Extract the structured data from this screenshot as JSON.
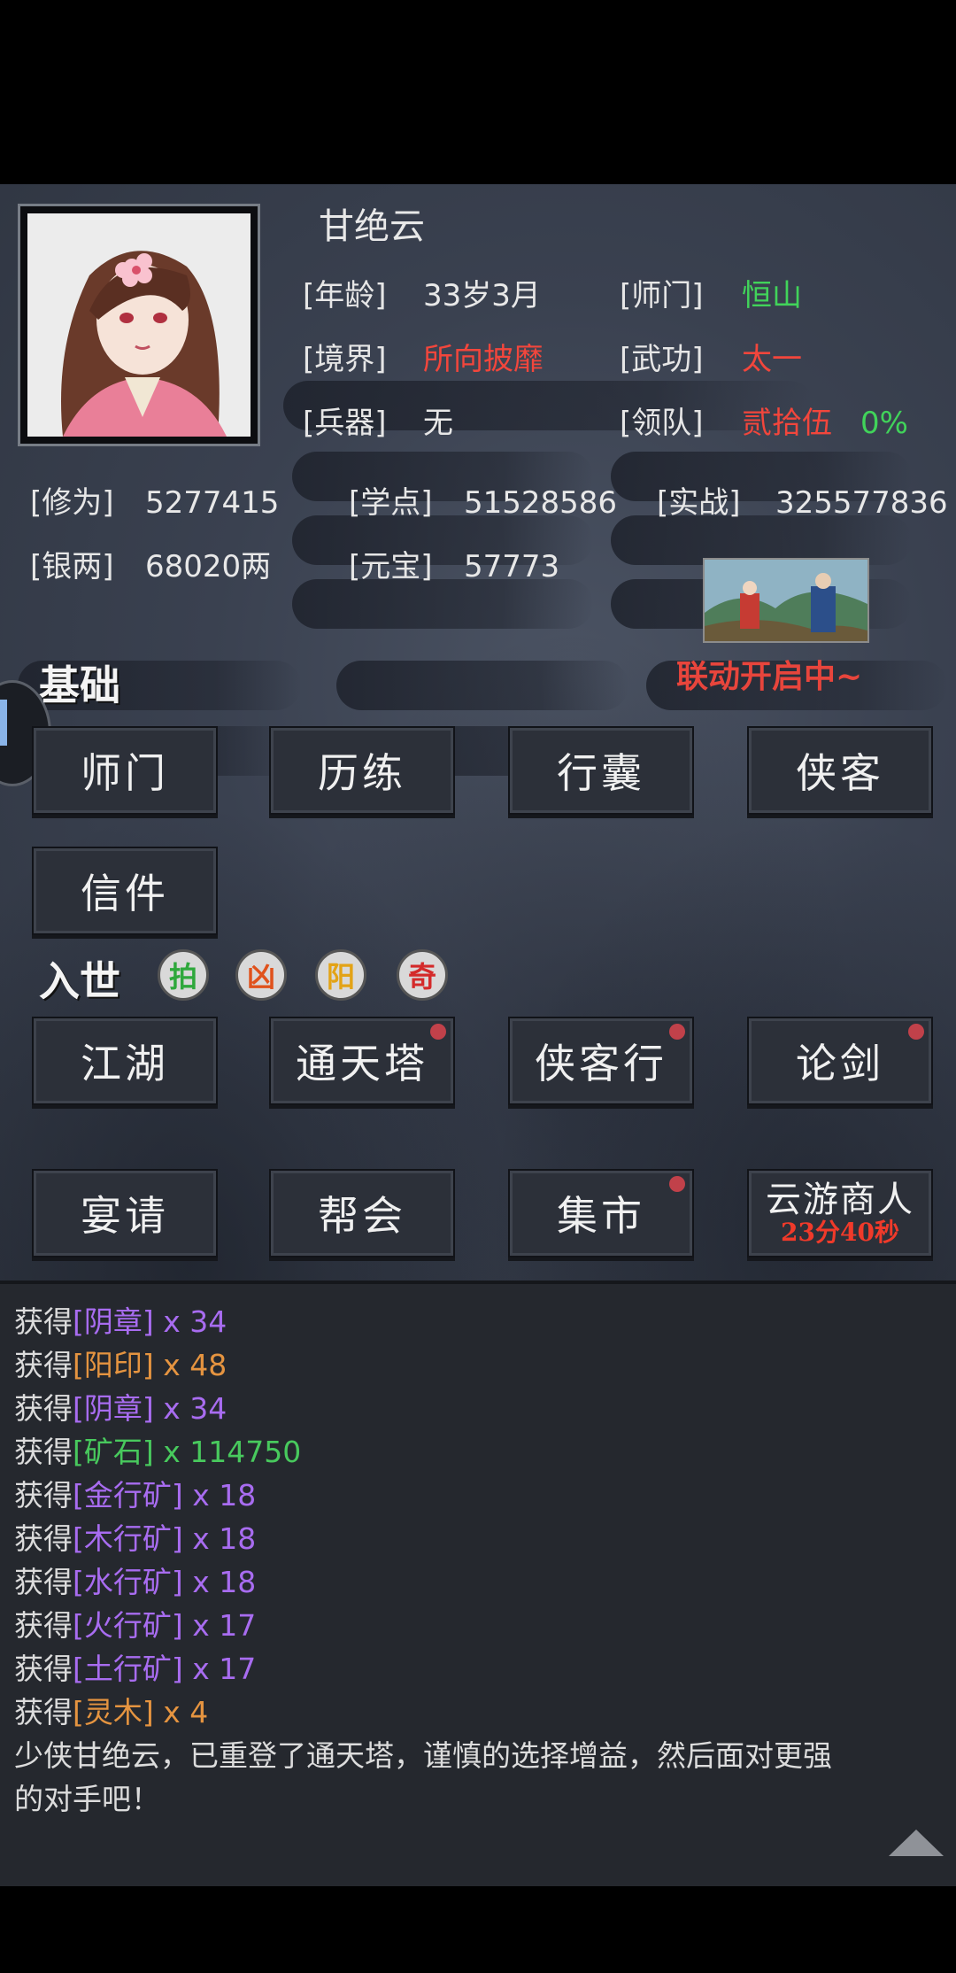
{
  "character": {
    "name": "甘绝云",
    "age_label": "[年龄]",
    "age_value": "33岁3月",
    "sect_label": "[师门]",
    "sect_value": "恒山",
    "realm_label": "[境界]",
    "realm_value": "所向披靡",
    "martial_label": "[武功]",
    "martial_value": "太一",
    "weapon_label": "[兵器]",
    "weapon_value": "无",
    "team_label": "[领队]",
    "team_value": "贰拾伍",
    "team_percent": "0%"
  },
  "stats": {
    "cultivation_label": "[修为]",
    "cultivation_value": "5277415",
    "study_label": "[学点]",
    "study_value": "51528586",
    "combat_label": "[实战]",
    "combat_value": "325577836",
    "silver_label": "[银两]",
    "silver_value": "68020两",
    "ingot_label": "[元宝]",
    "ingot_value": "57773"
  },
  "event": {
    "label": "联动开启中~"
  },
  "basic": {
    "title": "基础",
    "buttons": [
      "师门",
      "历练",
      "行囊",
      "侠客",
      "信件"
    ]
  },
  "world": {
    "title": "入世",
    "badges": [
      "拍",
      "凶",
      "阳",
      "奇"
    ],
    "badge_colors": [
      "#2fa83c",
      "#e0521c",
      "#e3a316",
      "#d42a2a"
    ],
    "buttons": [
      "江湖",
      "通天塔",
      "侠客行",
      "论剑",
      "宴请",
      "帮会",
      "集市",
      "云游商人"
    ],
    "merchant_timer": "23分40秒"
  },
  "log": {
    "lines": [
      {
        "prefix": "获得",
        "item": "[阴章]",
        "count": " x 34",
        "color": "purple"
      },
      {
        "prefix": "获得",
        "item": "[阳印]",
        "count": " x 48",
        "color": "orange"
      },
      {
        "prefix": "获得",
        "item": "[阴章]",
        "count": " x 34",
        "color": "purple"
      },
      {
        "prefix": "获得",
        "item": "[矿石]",
        "count": " x 114750",
        "color": "lgreen"
      },
      {
        "prefix": "获得",
        "item": "[金行矿]",
        "count": " x 18",
        "color": "purple"
      },
      {
        "prefix": "获得",
        "item": "[木行矿]",
        "count": " x 18",
        "color": "purple"
      },
      {
        "prefix": "获得",
        "item": "[水行矿]",
        "count": " x 18",
        "color": "purple"
      },
      {
        "prefix": "获得",
        "item": "[火行矿]",
        "count": " x 17",
        "color": "purple"
      },
      {
        "prefix": "获得",
        "item": "[土行矿]",
        "count": " x 17",
        "color": "purple"
      },
      {
        "prefix": "获得",
        "item": "[灵木]",
        "count": " x 4",
        "color": "orange"
      }
    ],
    "message_line1": "少侠甘绝云，已重登了通天塔，谨慎的选择增益，然后面对更强",
    "message_line2": "的对手吧！"
  },
  "colors": {
    "green": "#41d35a",
    "red": "#f2463c",
    "purple": "#a86cf0",
    "orange": "#e59440",
    "lgreen": "#48c95d"
  }
}
